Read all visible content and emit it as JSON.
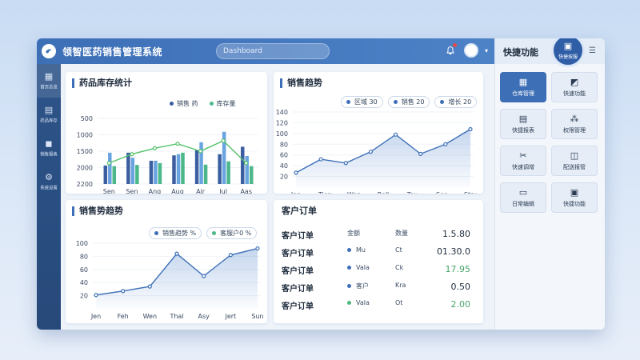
{
  "app": {
    "title": "领智医药销售管理系统",
    "search_placeholder": "Dashboard"
  },
  "sidebar": {
    "items": [
      {
        "icon": "grid-icon",
        "label": "首页总览"
      },
      {
        "icon": "document-icon",
        "label": "药品库存"
      },
      {
        "icon": "box-icon",
        "label": "销售报表"
      },
      {
        "icon": "gear-icon",
        "label": "系统设置"
      }
    ]
  },
  "cards": {
    "inventory": {
      "title": "药品库存统计",
      "legend": [
        "销售 药",
        "库存量"
      ]
    },
    "sales_trend": {
      "title": "销售趋势",
      "legend": [
        "区域 30",
        "销售 20",
        "增长 20"
      ]
    },
    "sales_trend2": {
      "title": "销售势趋势",
      "legend": [
        "销售趋势 %",
        "客服户0 %"
      ]
    },
    "orders": {
      "title": "客户订单",
      "header": {
        "c1": "客户订单",
        "c2": "金额",
        "c3": "数量",
        "c4": "1.5.80"
      },
      "rows": [
        {
          "c1": "客户订单",
          "c2": "Mu",
          "c3": "Ct",
          "c4": "01.30.0",
          "dot": "#3d6fb6",
          "color": "#1f2c3d"
        },
        {
          "c1": "客户订单",
          "c2": "Vala",
          "c3": "Ck",
          "c4": "17.95",
          "dot": "#3d6fb6",
          "color": "#4aa36a"
        },
        {
          "c1": "客户订单",
          "c2": "客户",
          "c3": "Kra",
          "c4": "0.50",
          "dot": "#3d6fb6",
          "color": "#1f2c3d"
        },
        {
          "c1": "客户订单",
          "c2": "Vala",
          "c3": "Ot",
          "c4": "2.00",
          "dot": "#4cb87a",
          "color": "#4aa36a"
        }
      ]
    }
  },
  "quick_panel": {
    "title": "快捷功能",
    "badge_label": "快捷按服",
    "menu_icon": "menu-icon",
    "buttons": [
      {
        "icon": "grid-icon",
        "label": "仓库管理",
        "active": true
      },
      {
        "icon": "chart-icon",
        "label": "快速功能",
        "active": false
      },
      {
        "icon": "document-icon",
        "label": "快捷报表",
        "active": false
      },
      {
        "icon": "nodes-icon",
        "label": "权限管理",
        "active": false
      },
      {
        "icon": "scissors-icon",
        "label": "快速调增",
        "active": false
      },
      {
        "icon": "box-icon",
        "label": "配送报管",
        "active": false
      },
      {
        "icon": "inbox-icon",
        "label": "日常编辑",
        "active": false
      },
      {
        "icon": "clipboard-icon",
        "label": "快捷功能",
        "active": false
      }
    ]
  },
  "chart_data": [
    {
      "type": "bar",
      "title": "药品库存统计",
      "categories": [
        "Sen",
        "Sen",
        "Ang",
        "Aug",
        "Air",
        "Jul",
        "Aas"
      ],
      "ylim": [
        0,
        2200
      ],
      "yticks": [
        0,
        500,
        1000,
        1500,
        2000
      ],
      "yticklabels": [
        "500",
        "1000",
        "1500",
        "2000",
        "2200"
      ],
      "series": [
        {
          "name": "销售 药",
          "kind": "bar",
          "color": "#3b5ea0",
          "values": [
            620,
            1050,
            780,
            960,
            1130,
            1000,
            1250
          ]
        },
        {
          "name": "库存量",
          "kind": "bar",
          "color": "#6aa4e0",
          "values": [
            1050,
            880,
            780,
            1000,
            1400,
            1750,
            940
          ]
        },
        {
          "name": "",
          "kind": "bar",
          "color": "#4cb88a",
          "values": [
            600,
            640,
            700,
            1050,
            650,
            760,
            600
          ]
        },
        {
          "name": "",
          "kind": "line",
          "color": "#55c26a",
          "values": [
            700,
            1000,
            1200,
            1350,
            1100,
            1450,
            700
          ]
        }
      ],
      "grid": true
    },
    {
      "type": "area",
      "title": "销售趋势",
      "categories": [
        "Jan",
        "Tien",
        "Wep",
        "Rell",
        "Tev",
        "Ser",
        "Stry"
      ],
      "ylim": [
        0,
        140
      ],
      "yticks": [
        20,
        40,
        60,
        80,
        100,
        120,
        140
      ],
      "yticklabels": [
        "20",
        "40",
        "60",
        "80",
        "100",
        "120",
        "140"
      ],
      "series": [
        {
          "name": "",
          "color": "#3d6fb6",
          "values": [
            27,
            52,
            45,
            66,
            98,
            62,
            80,
            108
          ]
        }
      ],
      "grid": true
    },
    {
      "type": "area",
      "title": "销售势趋势",
      "categories": [
        "Jen",
        "Feh",
        "Wen",
        "Thal",
        "Asy",
        "Jert",
        "Sun"
      ],
      "ylim": [
        0,
        100
      ],
      "yticks": [
        20,
        40,
        60,
        80,
        100
      ],
      "yticklabels": [
        "20",
        "40",
        "60",
        "80",
        "100"
      ],
      "series": [
        {
          "name": "",
          "color": "#3d6fb6",
          "values": [
            21,
            27,
            34,
            84,
            50,
            82,
            92
          ]
        }
      ],
      "grid": true
    }
  ]
}
